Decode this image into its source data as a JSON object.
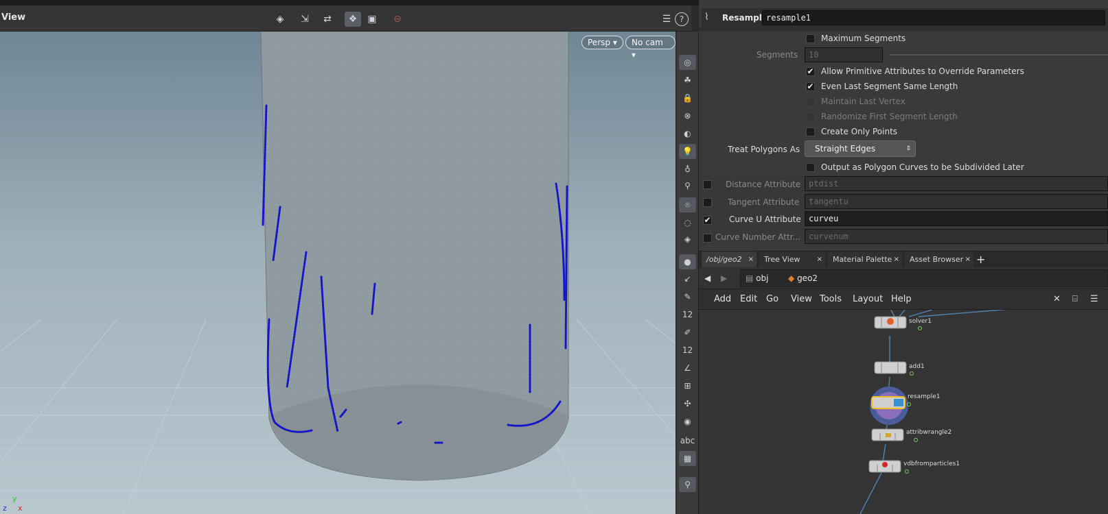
{
  "viewport": {
    "title": "View",
    "persp_label": "Persp",
    "cam_label": "No cam",
    "axes": {
      "x": "x",
      "y": "y",
      "z": "z"
    }
  },
  "toolbar_icons": [
    "select-icon",
    "transform-icon",
    "handle-icon",
    "snap-icon",
    "display-icon",
    "stop-icon"
  ],
  "shelf_icons": [
    "display-options-icon",
    "ghost-icon",
    "lock-icon",
    "visibility-icon",
    "shading-icon",
    "light-icon",
    "bulb-icon",
    "point-light-icon",
    "camera-icon",
    "view-icon",
    "render-icon",
    "point-icon",
    "edge-icon",
    "brush-icon",
    "number-icon",
    "paint-icon",
    "tag-icon",
    "angle-icon",
    "snap-grid-icon",
    "measure-icon",
    "circle-icon",
    "abc-icon",
    "image-icon",
    "pin-icon"
  ],
  "shelf_text": {
    "num1": "12",
    "num2": "12",
    "abc": "abc"
  },
  "params": {
    "node_type": "Resample",
    "node_name": "resample1",
    "max_segments_label": "Maximum Segments",
    "segments_label": "Segments",
    "segments_value": "10",
    "allow_prim_label": "Allow Primitive Attributes to Override Parameters",
    "even_last_label": "Even Last Segment Same Length",
    "maintain_last_label": "Maintain Last Vertex",
    "randomize_label": "Randomize First Segment Length",
    "create_points_label": "Create Only Points",
    "treat_polys_label": "Treat Polygons As",
    "treat_polys_value": "Straight Edges",
    "output_poly_label": "Output as Polygon Curves to be Subdivided Later",
    "dist_attr_label": "Distance Attribute",
    "dist_attr_value": "ptdist",
    "tangent_attr_label": "Tangent Attribute",
    "tangent_attr_value": "tangentu",
    "curveu_attr_label": "Curve U Attribute",
    "curveu_attr_value": "curveu",
    "curvenum_attr_label": "Curve Number Attr...",
    "curvenum_attr_value": "curvenum",
    "check_mark": "✔"
  },
  "tabs": [
    {
      "label": "/obj/geo2",
      "close": "×"
    },
    {
      "label": "Tree View",
      "close": "×"
    },
    {
      "label": "Material Palette",
      "close": "×"
    },
    {
      "label": "Asset Browser",
      "close": "×"
    }
  ],
  "add_tab": "+",
  "path": {
    "back": "◀",
    "forward": "▶",
    "obj": "obj",
    "geo": "geo2"
  },
  "net_menu": [
    "Add",
    "Edit",
    "Go",
    "View",
    "Tools",
    "Layout",
    "Help"
  ],
  "nodes": [
    {
      "label": "solver1"
    },
    {
      "label": "add1"
    },
    {
      "label": "resample1"
    },
    {
      "label": "attribwrangle2"
    },
    {
      "label": "vdbfromparticles1"
    }
  ],
  "help_icon": "?"
}
